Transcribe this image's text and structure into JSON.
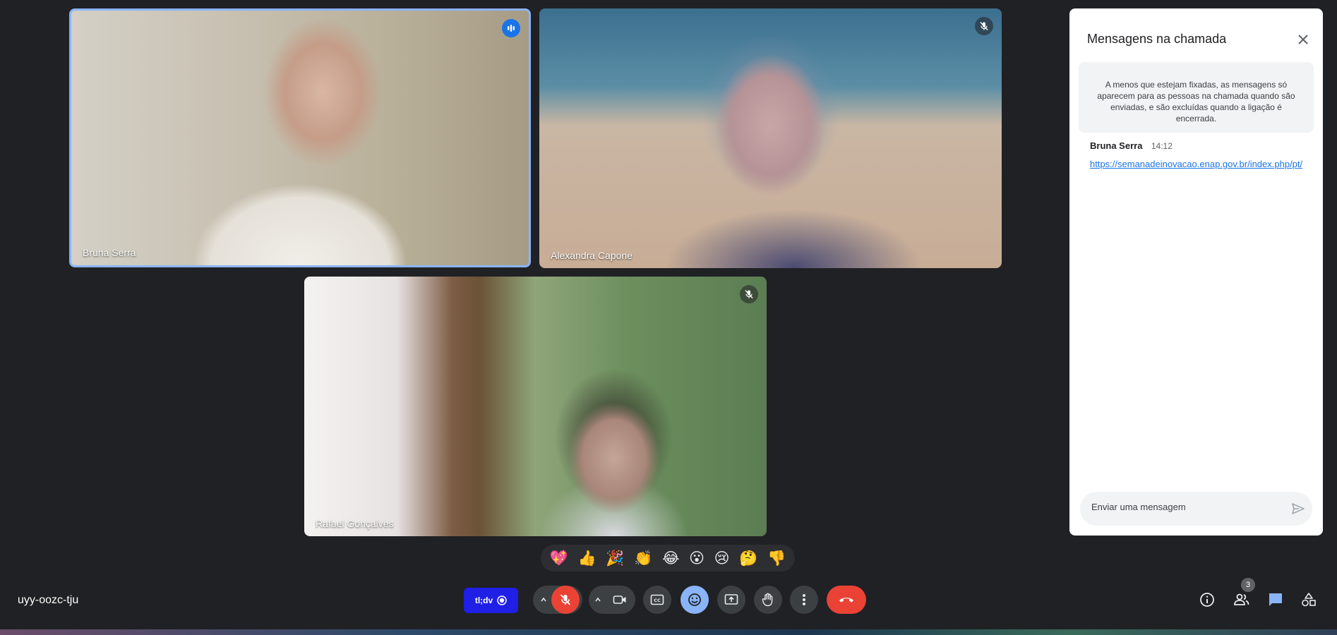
{
  "participants": [
    {
      "name": "Bruna Serra",
      "status": "speaking"
    },
    {
      "name": "Alexandra Capone",
      "status": "muted"
    },
    {
      "name": "Rafael Gonçalves",
      "status": "muted"
    }
  ],
  "chat": {
    "title": "Mensagens na chamada",
    "notice": "A menos que estejam fixadas, as mensagens só aparecem para as pessoas na chamada quando são enviadas, e são excluídas quando a ligação é encerrada.",
    "messages": [
      {
        "sender": "Bruna Serra",
        "time": "14:12",
        "link": "https://semanadeinovacao.enap.gov.br/index.php/pt/"
      }
    ],
    "input_placeholder": "Enviar uma mensagem"
  },
  "reactions": [
    "💖",
    "👍",
    "🎉",
    "👏",
    "😂",
    "😮",
    "😢",
    "🤔",
    "👎"
  ],
  "meeting_code": "uyy-oozc-tju",
  "toolbar": {
    "tldv_label": "tl;dv",
    "people_count": "3"
  },
  "colors": {
    "background": "#202124",
    "speaking_border": "#8ab4f8",
    "end_call": "#ea4335",
    "tldv": "#1f1fe6"
  }
}
